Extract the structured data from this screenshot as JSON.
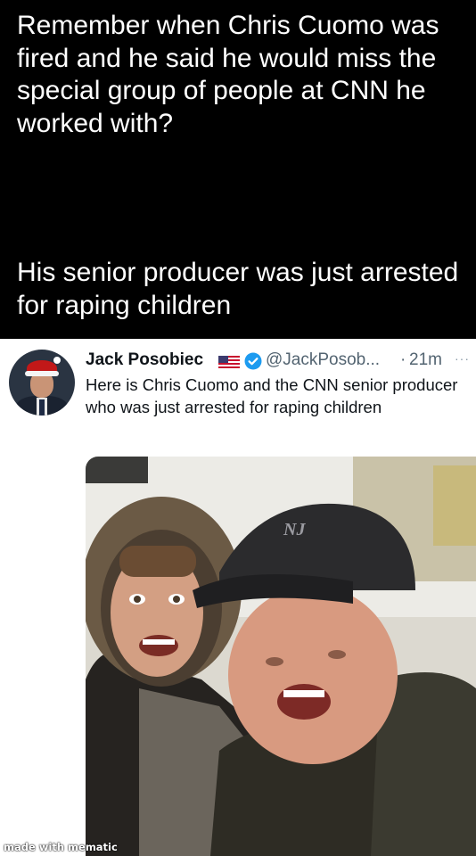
{
  "caption": {
    "paragraph1": "Remember when Chris Cuomo was fired and he said he would miss the special group of people at CNN he worked with?",
    "paragraph2": "His senior producer was just arrested for raping children"
  },
  "tweet": {
    "author_name": "Jack Posobiec",
    "handle": "@JackPosob...",
    "separator": "·",
    "time": "21m",
    "more": "···",
    "text": "Here is Chris Cuomo and the CNN senior producer who was just arrested for raping children",
    "icons": [
      "us-flag-icon",
      "verified-badge-icon",
      "more-options-icon"
    ],
    "colors": {
      "verified": "#1d9bf0",
      "secondary_text": "#536471"
    }
  },
  "photo": {
    "cap_logo": "NJ"
  },
  "watermark": "made with mematic"
}
